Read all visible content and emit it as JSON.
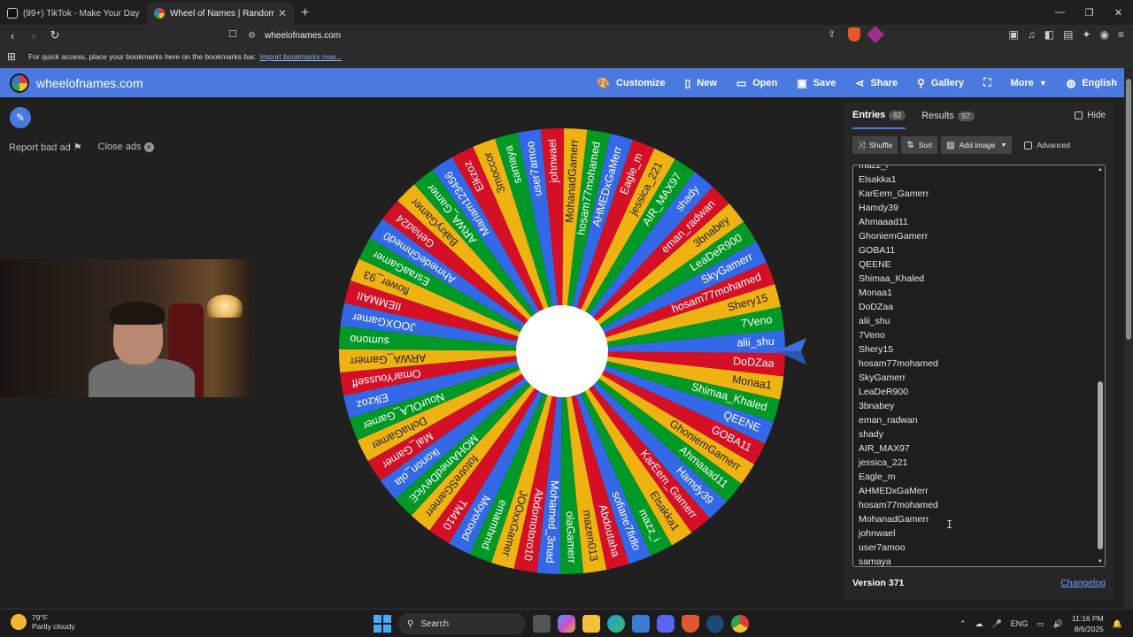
{
  "browser": {
    "tabs": [
      {
        "title": "(99+) TikTok - Make Your Day"
      },
      {
        "title": "Wheel of Names | Random name picker"
      }
    ],
    "url": "wheelofnames.com",
    "bookmarks_prompt": "For quick access, place your bookmarks here on the bookmarks bar.",
    "bookmarks_link": "Import bookmarks now..."
  },
  "app": {
    "site_name": "wheelofnames.com",
    "menu": {
      "customize": "Customize",
      "new": "New",
      "open": "Open",
      "save": "Save",
      "share": "Share",
      "gallery": "Gallery",
      "more": "More",
      "language": "English"
    },
    "report_bad_ad": "Report bad ad",
    "close_ads": "Close ads"
  },
  "wheel": {
    "colors": [
      "#3369e8",
      "#d50f25",
      "#eeb211",
      "#009925"
    ],
    "selected": "alii_shu",
    "segments": [
      "alii_shu",
      "DoDZaa",
      "Monaa1",
      "Shimaa_Khaled",
      "QEENE",
      "GOBA11",
      "GhoniemGamerr",
      "Ahmaaad11",
      "Hamdy39",
      "KarEem_Gamerr",
      "Elsakka1",
      "mazz_i",
      "sofiane7fidlo",
      "Abdoutaha",
      "mazen013",
      "olaGamerr",
      "Mohamed_3mad",
      "Abdomotoro10",
      "JOOxxGamer",
      "emamhmd",
      "Moyorood",
      "TM410",
      "fototreSGamerr",
      "MOHAmedDeVicE",
      "Ikonon_ola",
      "Mal_Gamer",
      "DohaGamer",
      "NourOLA_Gamer",
      "Elkzoz",
      "OmarYousseff",
      "ARWA_Gamerr",
      "sumono",
      "JOOXGamer",
      "IIEMMAII",
      "flower_93",
      "EsraaGamer",
      "AhmedeGhmed0",
      "Gehad24",
      "BakryGamer",
      "ARWA_Gamer",
      "Mariam123456",
      "Elkzoz",
      "3moccor",
      "samaya",
      "user7amoo",
      "johnwael",
      "MohanadGamerr",
      "hosam77mohamed",
      "AHMEDxGaMerr",
      "Eagle_m",
      "jessica_221",
      "AIR_MAX97",
      "shady",
      "eman_radwan",
      "3bnabey",
      "LeaDeR900",
      "SkyGamerr",
      "hosam77mohamed",
      "Shery15",
      "7Veno"
    ]
  },
  "panel": {
    "entries_tab": "Entries",
    "entries_count": "62",
    "results_tab": "Results",
    "results_count": "57",
    "hide_label": "Hide",
    "shuffle": "Shuffle",
    "sort": "Sort",
    "add_image": "Add image",
    "advanced": "Advanced",
    "entries": [
      "mazz_i",
      "Elsakka1",
      "KarEem_Gamerr",
      "Hamdy39",
      "Ahmaaad11",
      "GhoniemGamerr",
      "GOBA11",
      "QEENE",
      "Shimaa_Khaled",
      "Monaa1",
      "DoDZaa",
      "alii_shu",
      "7Veno",
      "Shery15",
      "hosam77mohamed",
      "SkyGamerr",
      "LeaDeR900",
      "3bnabey",
      "eman_radwan",
      "shady",
      "AIR_MAX97",
      "jessica_221",
      "Eagle_m",
      "AHMEDxGaMerr",
      "hosam77mohamed",
      "MohanadGamerr",
      "johnwael",
      "user7amoo",
      "samaya"
    ],
    "version": "Version 371",
    "changelog": "Changelog"
  },
  "taskbar": {
    "temperature": "79°F",
    "weather": "Partly cloudy",
    "search": "Search",
    "lang": "ENG",
    "time": "11:16 PM",
    "date": "8/6/2025"
  }
}
